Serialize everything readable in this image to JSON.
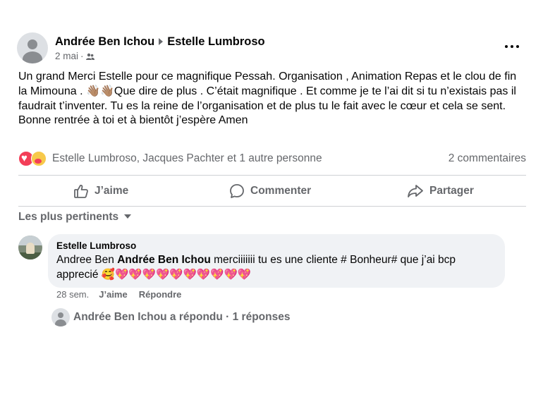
{
  "post": {
    "author": "Andrée Ben Ichou",
    "recipient": "Estelle Lumbroso",
    "date": "2 mai",
    "separator": "·",
    "audience_icon": "friends-icon",
    "more_icon": "more-options-icon",
    "body": [
      "Un grand Merci Estelle pour ce magnifique Pessah. Organisation , Animation Repas et le clou de fin la Mimouna .  👋🏽👋🏽Que dire de plus . C’était magnifique . Et comme je te l’ai dit si tu n’existais pas il faudrait t’inventer. Tu es la reine de l’organisation et de plus tu le fait avec le cœur et cela se sent.",
      "Bonne rentrée à toi et à bientôt j’espère Amen"
    ]
  },
  "reactions": {
    "icons": [
      "love-reaction-icon",
      "care-reaction-icon"
    ],
    "names": "Estelle Lumbroso, Jacques Pachter et 1 autre personne",
    "comment_count": "2 commentaires"
  },
  "actions": {
    "like": "J’aime",
    "comment": "Commenter",
    "share": "Partager"
  },
  "sort": {
    "label": "Les plus pertinents"
  },
  "comment": {
    "author": "Estelle Lumbroso",
    "text_prefix": "Andree Ben ",
    "mention": "Andrée Ben Ichou",
    "text_suffix": " merciiiiiii tu es une cliente # Bonheur# que j’ai bcp apprecié 🥰💖💖💖💖💖💖💖💖💖💖",
    "time": "28 sem.",
    "like": "J’aime",
    "reply": "Répondre"
  },
  "replies": {
    "text": "Andrée Ben Ichou a répondu · 1 réponses"
  },
  "colors": {
    "text_primary": "#050505",
    "text_secondary": "#65676b",
    "divider": "#ced0d4",
    "bubble": "#f0f2f5",
    "love": "#f33e58",
    "care": "#f7c94a"
  }
}
